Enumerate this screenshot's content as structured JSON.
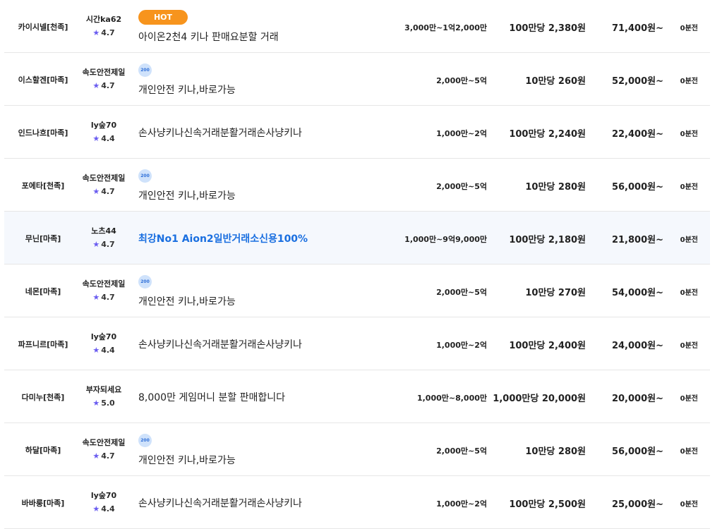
{
  "rows": [
    {
      "server": "카이시넬[천족]",
      "seller": "시간ka62",
      "rating": "4.7",
      "badge": "HOT",
      "title": "아이온2천4 키나 판매요분할 거래",
      "range": "3,000만~1억2,000만",
      "unit_price": "100만당 2,380원",
      "min_price": "71,400원~",
      "time": "0분전"
    },
    {
      "server": "이스할겐[마족]",
      "seller": "속도안전제일",
      "rating": "4.7",
      "badge": "200",
      "title": "개인안전 키나,바로가능",
      "range": "2,000만~5억",
      "unit_price": "10만당 260원",
      "min_price": "52,000원~",
      "time": "0분전"
    },
    {
      "server": "인드나흐[마족]",
      "seller": "ly숲70",
      "rating": "4.4",
      "badge": "",
      "title": "손사냥키나신속거래분활거래손사냥키나",
      "range": "1,000만~2억",
      "unit_price": "100만당 2,240원",
      "min_price": "22,400원~",
      "time": "0분전"
    },
    {
      "server": "포에타[천족]",
      "seller": "속도안전제일",
      "rating": "4.7",
      "badge": "200",
      "title": "개인안전 키나,바로가능",
      "range": "2,000만~5억",
      "unit_price": "10만당 280원",
      "min_price": "56,000원~",
      "time": "0분전"
    },
    {
      "server": "무닌[마족]",
      "seller": "노츠44",
      "rating": "4.7",
      "badge": "",
      "title": "최강No1 Aion2일반거래소신용100%",
      "range": "1,000만~9억9,000만",
      "unit_price": "100만당 2,180원",
      "min_price": "21,800원~",
      "time": "0분전",
      "featured": true
    },
    {
      "server": "네몬[마족]",
      "seller": "속도안전제일",
      "rating": "4.7",
      "badge": "200",
      "title": "개인안전 키나,바로가능",
      "range": "2,000만~5억",
      "unit_price": "10만당 270원",
      "min_price": "54,000원~",
      "time": "0분전"
    },
    {
      "server": "파프니르[마족]",
      "seller": "ly숲70",
      "rating": "4.4",
      "badge": "",
      "title": "손사냥키나신속거래분활거래손사냥키나",
      "range": "1,000만~2억",
      "unit_price": "100만당 2,400원",
      "min_price": "24,000원~",
      "time": "0분전"
    },
    {
      "server": "다미누[천족]",
      "seller": "부자되세요",
      "rating": "5.0",
      "badge": "",
      "title": "8,000만 게임머니 분할 판매합니다",
      "range": "1,000만~8,000만",
      "unit_price": "1,000만당 20,000원",
      "min_price": "20,000원~",
      "time": "0분전"
    },
    {
      "server": "하달[마족]",
      "seller": "속도안전제일",
      "rating": "4.7",
      "badge": "200",
      "title": "개인안전 키나,바로가능",
      "range": "2,000만~5억",
      "unit_price": "10만당 280원",
      "min_price": "56,000원~",
      "time": "0분전"
    },
    {
      "server": "바바룽[마족]",
      "seller": "ly숲70",
      "rating": "4.4",
      "badge": "",
      "title": "손사냥키나신속거래분활거래손사냥키나",
      "range": "1,000만~2억",
      "unit_price": "100만당 2,500원",
      "min_price": "25,000원~",
      "time": "0분전"
    }
  ],
  "icons": {
    "rating": "star-icon",
    "badge_200": "power-seller-badge-icon"
  },
  "colors": {
    "accent": "#1a6fe0",
    "hot": "#f7941d",
    "star": "#6a5cf0",
    "highlight": "#f5f8fd"
  }
}
